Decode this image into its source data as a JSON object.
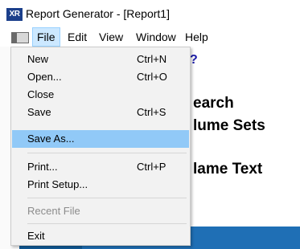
{
  "window": {
    "icon_text": "XR",
    "title": "Report Generator - [Report1]"
  },
  "menubar": {
    "items": [
      {
        "label": "File",
        "active": true
      },
      {
        "label": "Edit"
      },
      {
        "label": "View"
      },
      {
        "label": "Window"
      },
      {
        "label": "Help"
      }
    ]
  },
  "file_menu": {
    "items": [
      {
        "label": "New",
        "shortcut": "Ctrl+N"
      },
      {
        "label": "Open...",
        "shortcut": "Ctrl+O"
      },
      {
        "label": "Close",
        "shortcut": ""
      },
      {
        "label": "Save",
        "shortcut": "Ctrl+S"
      },
      {
        "label": "Save As...",
        "shortcut": "",
        "highlighted": true
      },
      {
        "label": "Print...",
        "shortcut": "Ctrl+P"
      },
      {
        "label": "Print Setup...",
        "shortcut": ""
      },
      {
        "label": "Recent File",
        "shortcut": "",
        "disabled": true
      },
      {
        "label": "Exit",
        "shortcut": ""
      }
    ]
  },
  "document": {
    "hint": "?",
    "heading_1": "earch",
    "heading_2": "lume Sets",
    "heading_3": "lame Text"
  },
  "colors": {
    "highlight": "#91c9f7",
    "menu_active": "#cce8ff",
    "bottom_band": "#1f6fb5",
    "hint_text": "#1a1aa8"
  }
}
